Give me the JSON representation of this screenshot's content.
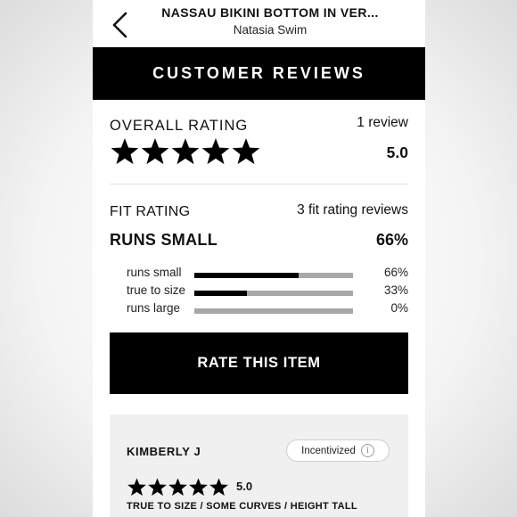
{
  "header": {
    "title": "NASSAU BIKINI BOTTOM IN VER...",
    "brand": "Natasia Swim",
    "back_icon": "chevron-left-icon"
  },
  "section": {
    "title": "CUSTOMER REVIEWS"
  },
  "overall": {
    "label": "OVERALL RATING",
    "review_count": "1 review",
    "stars_filled": 5,
    "stars_total": 5,
    "value": "5.0"
  },
  "fit": {
    "label": "FIT RATING",
    "count": "3 fit rating reviews",
    "verdict": "RUNS SMALL",
    "verdict_pct": "66%",
    "rows": [
      {
        "label": "runs small",
        "percent": 66,
        "pct_text": "66%"
      },
      {
        "label": "true to size",
        "percent": 33,
        "pct_text": "33%"
      },
      {
        "label": "runs large",
        "percent": 0,
        "pct_text": "0%"
      }
    ]
  },
  "actions": {
    "rate_label": "RATE THIS ITEM"
  },
  "review": {
    "name": "KIMBERLY J",
    "badge": "Incentivized",
    "badge_icon": "info-icon",
    "info_glyph": "i",
    "stars_filled": 5,
    "rating": "5.0",
    "attributes": "TRUE TO SIZE / SOME CURVES / HEIGHT TALL"
  },
  "colors": {
    "primary": "#000000",
    "bar_track": "#a8a8a8",
    "card_bg": "#f0f0f0",
    "text": "#111111"
  }
}
